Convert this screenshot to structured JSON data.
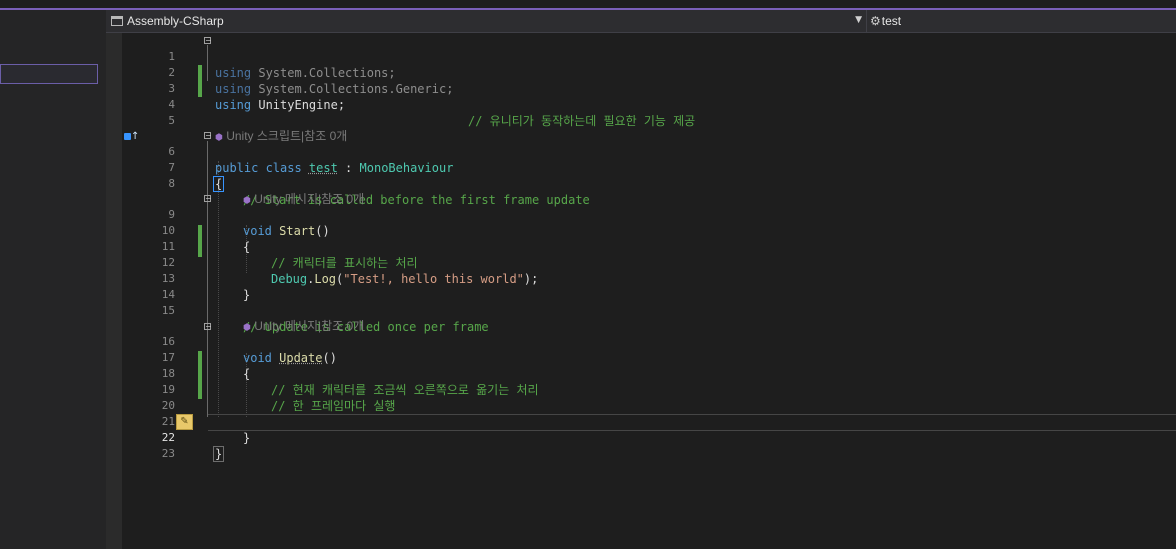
{
  "navbar": {
    "project": "Assembly-CSharp",
    "member": "test"
  },
  "code": {
    "ln1": "1",
    "ln2": "2",
    "ln3": "3",
    "ln4": "4",
    "ln5": "5",
    "ln6": "6",
    "ln7": "7",
    "ln8": "8",
    "ln9": "9",
    "ln10": "10",
    "ln11": "11",
    "ln12": "12",
    "ln13": "13",
    "ln14": "14",
    "ln15": "15",
    "ln16": "16",
    "ln17": "17",
    "ln18": "18",
    "ln19": "19",
    "ln20": "20",
    "ln21": "21",
    "ln22": "22",
    "ln23": "23",
    "l1_using": "using",
    "l1_ns": " System.Collections;",
    "l2_using": "using",
    "l2_ns": " System.Collections.Generic;",
    "l3_using": "using",
    "l3_ns": " UnityEngine;",
    "l3_comment": "// 유니티가 동작하는데 필요한 기능 제공",
    "cl_class": "Unity 스크립트|참조 0개",
    "l6_kw": "public class ",
    "l6_name": "test",
    "l6_colon": " : ",
    "l6_base": "MonoBehaviour",
    "l7_brace": "{",
    "l8_comment": "// Start is called before the first frame update",
    "cl_start": "Unity 메시지|참조 0개",
    "l9_kw": "void ",
    "l9_fn": "Start",
    "l9_paren": "()",
    "l10_brace": "{",
    "l11_comment": "// 캐릭터를 표시하는 처리",
    "l12_obj": "Debug",
    "l12_dot": ".",
    "l12_fn": "Log",
    "l12_open": "(",
    "l12_str": "\"Test!, hello this world\"",
    "l12_close": ");",
    "l13_brace": "}",
    "l15_comment": "// Update is called once per frame",
    "cl_update": "Unity 메시지|참조 0개",
    "l16_kw": "void ",
    "l16_fn": "Update",
    "l16_paren": "()",
    "l17_brace": "{",
    "l18_comment": "// 현재 캐릭터를 조금씩 오른쪽으로 옮기는 처리",
    "l19_comment": "// 한 프레임마다 실행",
    "l21_brace": "}",
    "l22_brace": "}"
  },
  "colors": {
    "keyword": "#569cd6",
    "type": "#4ec9b0",
    "method": "#dcdcaa",
    "string": "#d69d85",
    "comment": "#57a64a",
    "change_marker": "#57a64a"
  },
  "icons": {
    "project": "csharp-project-icon",
    "member": "class-member-icon",
    "dropdown": "chevron-down-icon",
    "codelens": "unity-icon",
    "quick_action": "lightbulb-icon",
    "margin": "override-marker-icon"
  }
}
